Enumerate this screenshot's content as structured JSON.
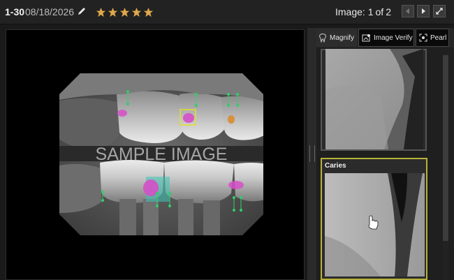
{
  "header": {
    "record_id": "1-30",
    "date": "08/18/2026",
    "rating": 5,
    "image_label": "Image:",
    "image_current": "1",
    "image_of": "of",
    "image_total": "2"
  },
  "viewer": {
    "watermark": "SAMPLE IMAGE"
  },
  "panel": {
    "tabs": [
      {
        "label": "Magnify",
        "icon": "tooth-icon"
      },
      {
        "label": "Image Verify",
        "icon": "image-verify-icon"
      },
      {
        "label": "Pearl",
        "icon": "pearl-icon"
      }
    ],
    "cards": [
      {
        "title": ""
      },
      {
        "title": "Caries"
      }
    ]
  },
  "colors": {
    "star": "#e0a84a",
    "caries_highlight": "#d64fc8",
    "selection_box": "#e2df2a",
    "active_card_border": "#b8b13a",
    "marker_green": "#2fd06a",
    "restoration_teal": "#3cc5b5",
    "orange_marker": "#d98c2e"
  }
}
